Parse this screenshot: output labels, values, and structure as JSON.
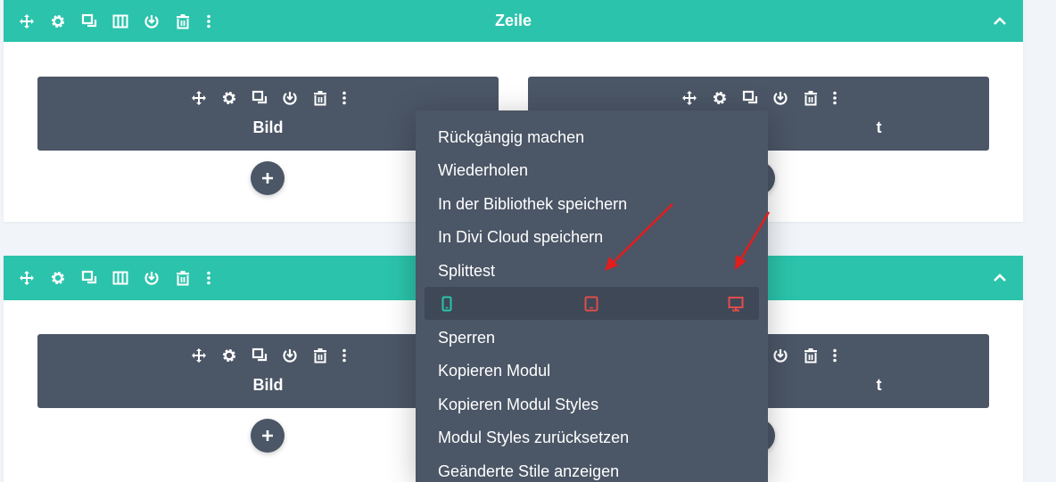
{
  "row1": {
    "title": "Zeile"
  },
  "modules": [
    {
      "title": "Bild"
    },
    {
      "title": "t"
    },
    {
      "title": "Bild"
    },
    {
      "title": "t"
    }
  ],
  "context_menu": {
    "items": [
      "Rückgängig machen",
      "Wiederholen",
      "In der Bibliothek speichern",
      "In Divi Cloud speichern",
      "Splittest",
      "Sperren",
      "Kopieren Modul",
      "Kopieren Modul Styles",
      "Modul Styles zurücksetzen",
      "Geänderte Stile anzeigen"
    ],
    "devices": [
      "phone-icon",
      "tablet-icon",
      "desktop-icon"
    ]
  },
  "colors": {
    "row_bar": "#2bc3ab",
    "module_bg": "#4b5666",
    "menu_bg": "#4b5666",
    "phone_active": "#2bc3ab",
    "device_disabled": "#e24c4c",
    "arrow": "#e01e1e"
  }
}
